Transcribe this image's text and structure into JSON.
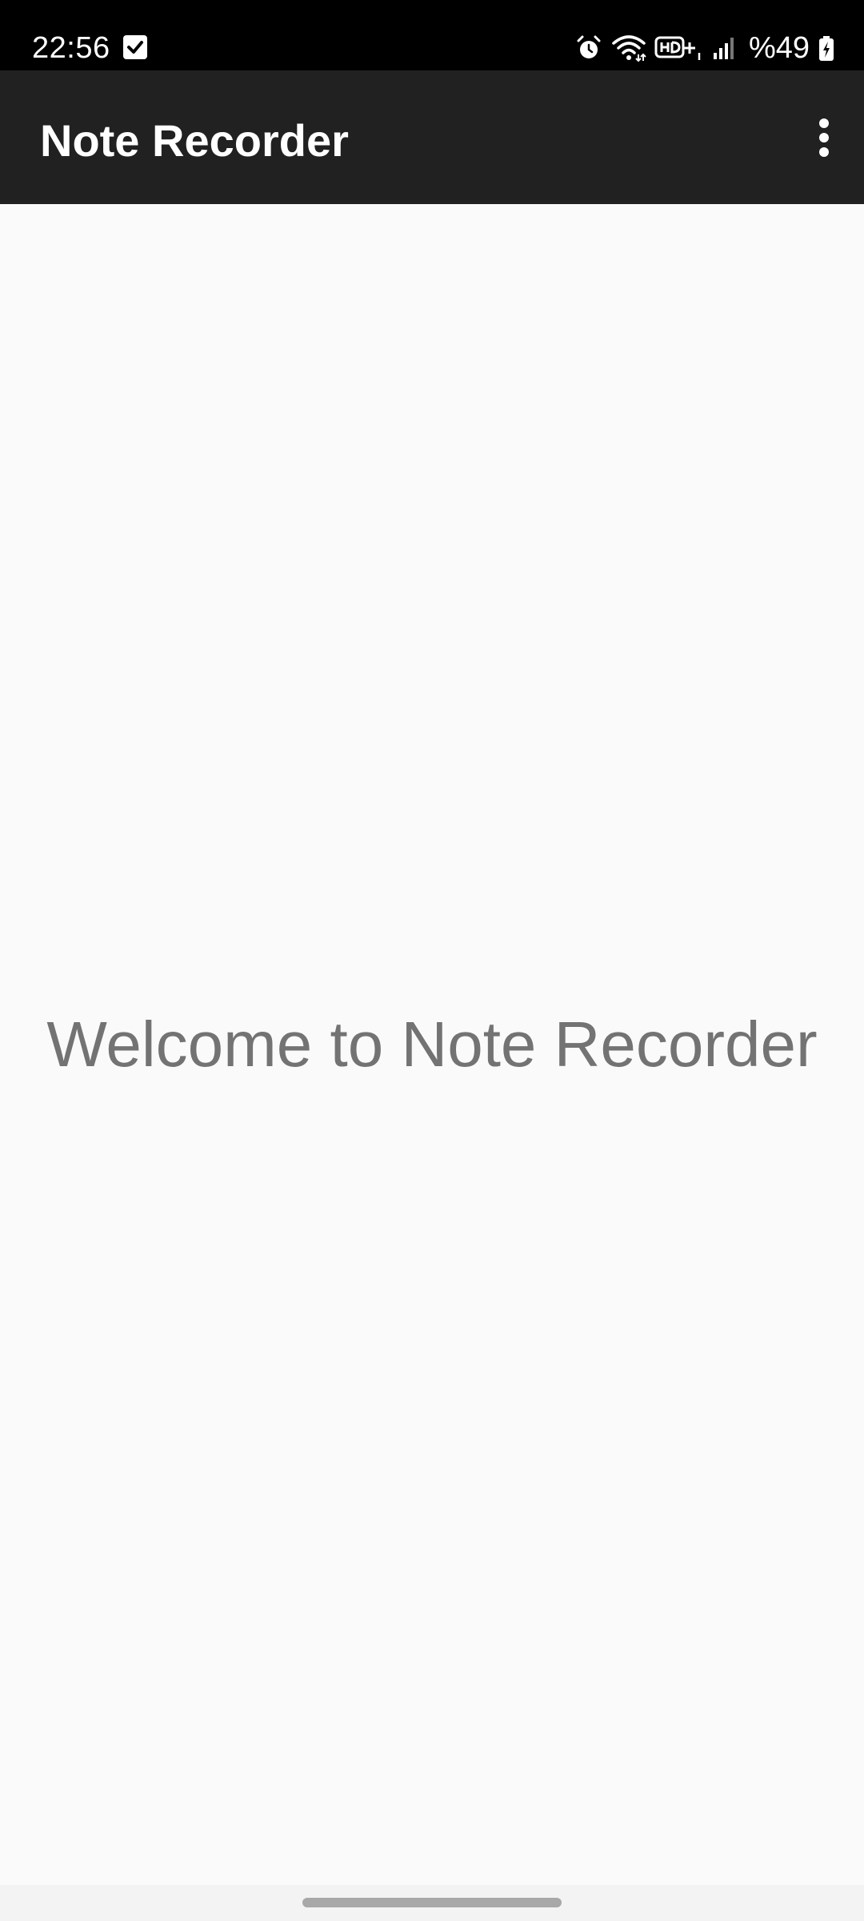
{
  "status_bar": {
    "time": "22:56",
    "battery": "%49",
    "icons": [
      "checkbox-notification-icon",
      "alarm-icon",
      "wifi-icon",
      "hd-voice-icon",
      "signal-icon",
      "battery-charging-icon"
    ]
  },
  "app_bar": {
    "title": "Note Recorder",
    "menu_icon": "more-vert-icon"
  },
  "main": {
    "welcome_text": "Welcome to Note Recorder"
  },
  "colors": {
    "status_bar_bg": "#000000",
    "app_bar_bg": "#212121",
    "content_bg": "#fafafa",
    "welcome_text": "#737373"
  }
}
